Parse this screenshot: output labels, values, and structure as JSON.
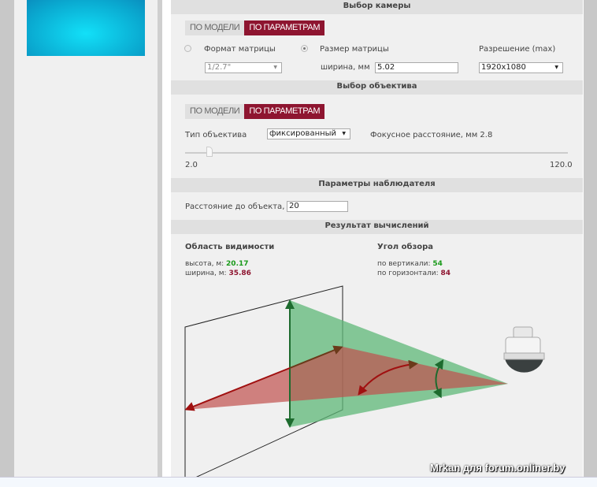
{
  "camera_section": {
    "title": "Выбор камеры",
    "tabs": [
      "ПО МОДЕЛИ",
      "ПО ПАРАМЕТРАМ"
    ],
    "matrix_format_label": "Формат матрицы",
    "matrix_format_value": "1/2.7\"",
    "matrix_size_label": "Размер матрицы",
    "width_label": "ширина, мм",
    "width_value": "5.02",
    "resolution_label": "Разрешение (max)",
    "resolution_value": "1920x1080"
  },
  "lens_section": {
    "title": "Выбор объектива",
    "tabs": [
      "ПО МОДЕЛИ",
      "ПО ПАРАМЕТРАМ"
    ],
    "lens_type_label": "Тип объектива",
    "lens_type_value": "фиксированный",
    "focal_label": "Фокусное расстояние, мм 2.8",
    "slider_min": "2.0",
    "slider_max": "120.0",
    "slider_value": 2.8
  },
  "observer_section": {
    "title": "Параметры наблюдателя",
    "distance_label": "Расстояние до объекта, м",
    "distance_value": "20"
  },
  "result_section": {
    "title": "Результат вычислений",
    "visibility_title": "Область видимости",
    "height_label": "высота, м:",
    "height_value": "20.17",
    "width_label": "ширина, м:",
    "width_value": "35.86",
    "angle_title": "Угол обзора",
    "vertical_label": "по вертикали:",
    "vertical_value": "54",
    "horizontal_label": "по горизонтали:",
    "horizontal_value": "84"
  },
  "watermark": "Mrkan для forum.onliner.by",
  "colors": {
    "accent": "#8e1530",
    "green": "#1a9a1a"
  }
}
